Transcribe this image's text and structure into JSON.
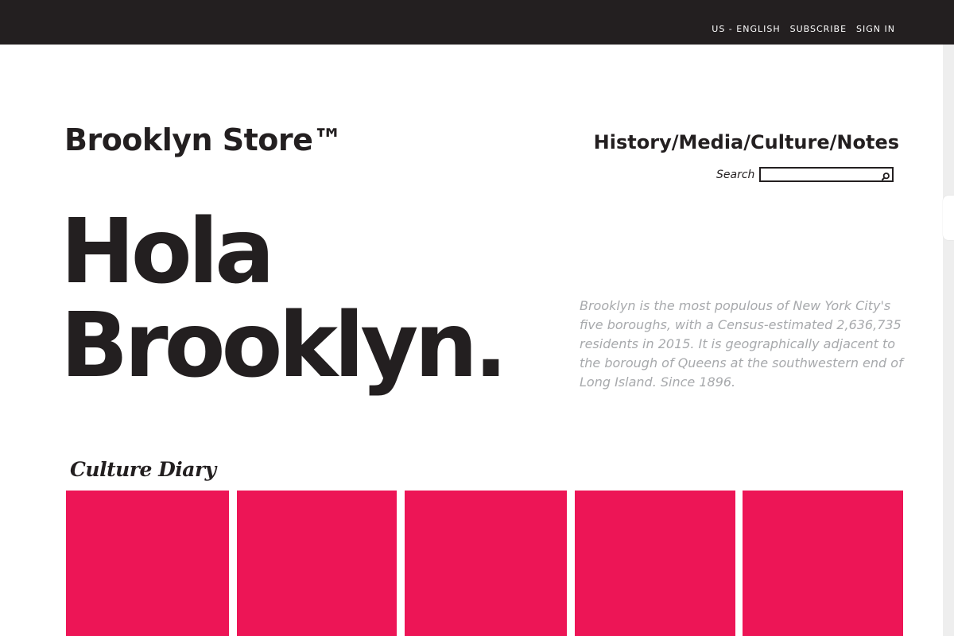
{
  "topbar": {
    "links": [
      "US - ENGLISH",
      "SUBSCRIBE",
      "SIGN IN"
    ]
  },
  "header": {
    "brand": "Brooklyn Store™",
    "nav": [
      "History",
      "Media",
      "Culture",
      "Notes"
    ],
    "nav_separator": "/",
    "search_label": "Search",
    "search_placeholder": "",
    "search_icon": "search-icon"
  },
  "hero": {
    "title_line1": "Hola",
    "title_line2": "Brooklyn.",
    "description": "Brooklyn is the most populous of New York City's five boroughs, with a Census-estimated 2,636,735 residents in 2015. It is geographically adjacent to the borough of Queens at the southwestern end of Long Island. Since 1896."
  },
  "culture_diary": {
    "title": "Culture Diary",
    "tile_color": "#ed1556",
    "tile_count": 5
  },
  "colors": {
    "topbar_bg": "#231f20",
    "text_dark": "#231f20",
    "text_muted": "#a7a9ac",
    "accent": "#ed1556"
  }
}
